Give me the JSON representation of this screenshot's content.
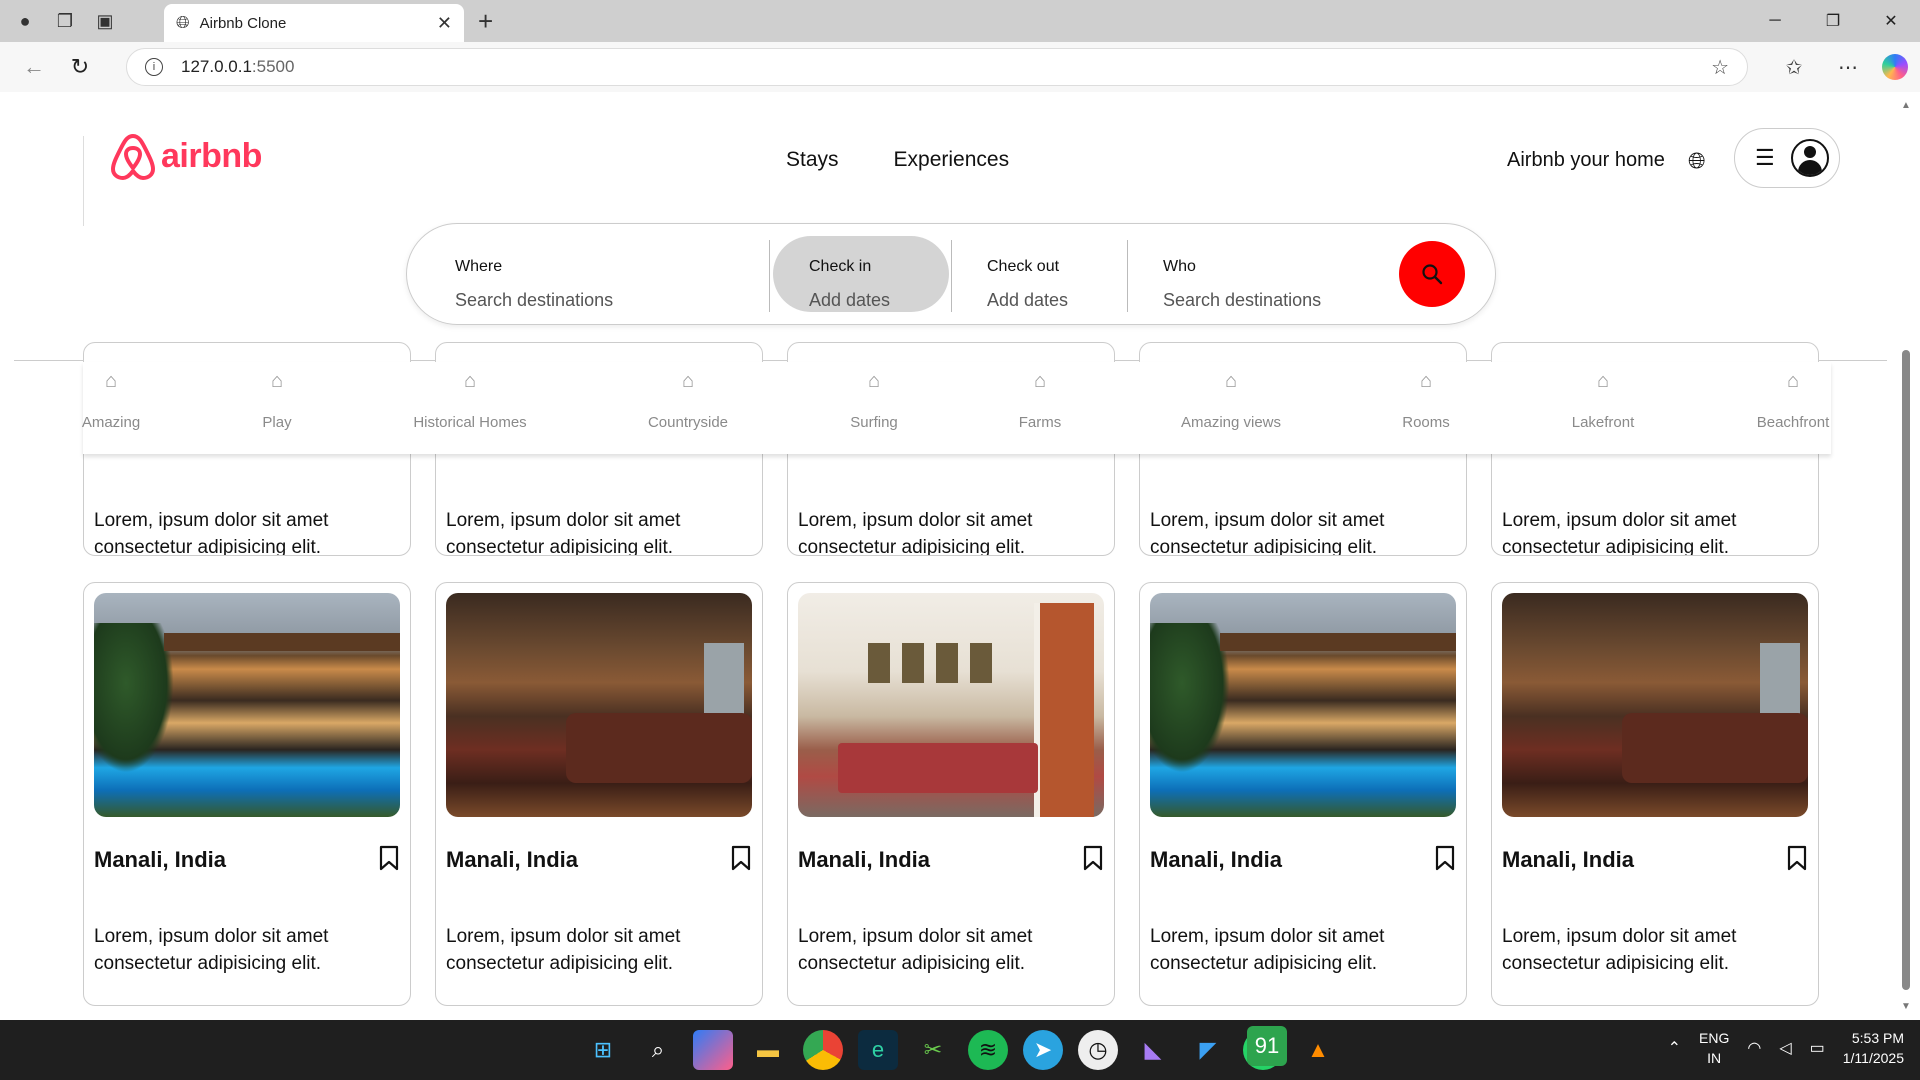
{
  "browser": {
    "tab_title": "Airbnb Clone",
    "url_host": "127.0.0.1",
    "url_port": ":5500"
  },
  "header": {
    "brand": "airbnb",
    "nav": [
      "Stays",
      "Experiences"
    ],
    "host_link": "Airbnb your home"
  },
  "search": {
    "where_label": "Where",
    "where_placeholder": "Search destinations",
    "checkin_label": "Check in",
    "checkin_value": "Add dates",
    "checkout_label": "Check out",
    "checkout_value": "Add dates",
    "who_label": "Who",
    "who_placeholder": "Search destinations"
  },
  "categories": [
    "Amazing",
    "Play",
    "Historical Homes",
    "Countryside",
    "Surfing",
    "Farms",
    "Amazing views",
    "Rooms",
    "Lakefront",
    "Beachfront"
  ],
  "listings": {
    "top_row": [
      {
        "desc": "Lorem, ipsum dolor sit amet consectetur adipisicing elit."
      },
      {
        "desc": "Lorem, ipsum dolor sit amet consectetur adipisicing elit."
      },
      {
        "desc": "Lorem, ipsum dolor sit amet consectetur adipisicing elit."
      },
      {
        "desc": "Lorem, ipsum dolor sit amet consectetur adipisicing elit."
      },
      {
        "desc": "Lorem, ipsum dolor sit amet consectetur adipisicing elit."
      }
    ],
    "bottom_row": [
      {
        "place": "Manali, India",
        "photo": "villa",
        "desc": "Lorem, ipsum dolor sit amet consectetur adipisicing elit."
      },
      {
        "place": "Manali, India",
        "photo": "lounge",
        "desc": "Lorem, ipsum dolor sit amet consectetur adipisicing elit."
      },
      {
        "place": "Manali, India",
        "photo": "dining",
        "desc": "Lorem, ipsum dolor sit amet consectetur adipisicing elit."
      },
      {
        "place": "Manali, India",
        "photo": "villa",
        "desc": "Lorem, ipsum dolor sit amet consectetur adipisicing elit."
      },
      {
        "place": "Manali, India",
        "photo": "lounge",
        "desc": "Lorem, ipsum dolor sit amet consectetur adipisicing elit."
      }
    ]
  },
  "taskbar": {
    "whatsapp_badge": "91",
    "lang_line1": "ENG",
    "lang_line2": "IN",
    "time": "5:53 PM",
    "date": "1/11/2025"
  },
  "colors": {
    "brand": "#ff385c",
    "search_button": "#ff0000"
  }
}
